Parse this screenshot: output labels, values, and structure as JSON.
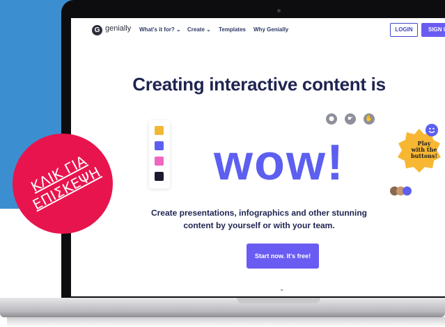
{
  "nav": {
    "logo_text": "genially",
    "logo_letter": "G",
    "links": [
      "What's it for? ⌄",
      "Create ⌄",
      "Templates",
      "Why Genially"
    ],
    "login_label": "LOGIN",
    "signup_label": "SIGN U"
  },
  "hero": {
    "headline": "Creating interactive content is",
    "wow": "wow!",
    "subtitle_line1": "Create presentations, infographics and other stunning",
    "subtitle_line2": "content by yourself or with your team.",
    "cta_label": "Start now. It's free!",
    "scroll_chevron": "⌄"
  },
  "sticker": {
    "line1": "Play",
    "line2": "with the",
    "line3": "buttons!"
  },
  "badge": {
    "line1": "ΚΛΙΚ ΓΙΑ",
    "line2": "ΕΠΙΣΚΕΨΗ"
  },
  "colors": {
    "accent": "#6a5cf2",
    "wow": "#5d5ff0",
    "badge": "#e8144e",
    "headline": "#1f2451",
    "background_blue": "#3b8fd0",
    "swatches": [
      "#f3b736",
      "#5d5ff0",
      "#f067c1",
      "#1a1a2e"
    ]
  },
  "icons": [
    "genially-logo-icon",
    "dot-control-icon",
    "pointer-control-icon",
    "hand-control-icon",
    "smiley-icon"
  ]
}
